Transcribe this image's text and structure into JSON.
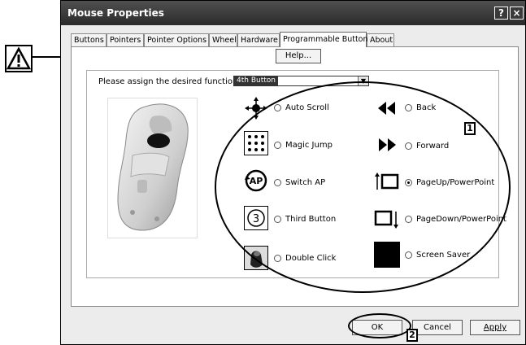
{
  "window": {
    "title": "Mouse Properties",
    "help_glyph": "?",
    "close_glyph": "×"
  },
  "tabs": [
    {
      "label": "Buttons"
    },
    {
      "label": "Pointers"
    },
    {
      "label": "Pointer Options"
    },
    {
      "label": "Wheel"
    },
    {
      "label": "Hardware"
    },
    {
      "label": "Programmable Button",
      "active": true
    },
    {
      "label": "About"
    }
  ],
  "help_button": {
    "label": "Help..."
  },
  "assign": {
    "label": "Please assign the desired function to the",
    "selected": "4th Button"
  },
  "options_left": [
    {
      "label": "Auto Scroll",
      "icon": "auto-scroll-icon",
      "selected": false
    },
    {
      "label": "Magic Jump",
      "icon": "magic-jump-icon",
      "selected": false
    },
    {
      "label": "Switch AP",
      "icon": "switch-ap-icon",
      "selected": false
    },
    {
      "label": "Third Button",
      "icon": "third-button-icon",
      "selected": false
    },
    {
      "label": "Double Click",
      "icon": "double-click-icon",
      "selected": false
    }
  ],
  "options_right": [
    {
      "label": "Back",
      "icon": "back-icon",
      "selected": false
    },
    {
      "label": "Forward",
      "icon": "forward-icon",
      "selected": false
    },
    {
      "label": "PageUp/PowerPoint",
      "icon": "page-up-icon",
      "selected": true
    },
    {
      "label": "PageDown/PowerPoint",
      "icon": "page-down-icon",
      "selected": false
    },
    {
      "label": "Screen Saver",
      "icon": "screen-saver-icon",
      "selected": false
    }
  ],
  "icon_text": {
    "switch_ap": "AP",
    "third_button": "3"
  },
  "footer": {
    "ok": "OK",
    "cancel": "Cancel",
    "apply": "Apply"
  },
  "callouts": {
    "one": "1",
    "two": "2"
  },
  "warning_icon": "warning-triangle-icon"
}
